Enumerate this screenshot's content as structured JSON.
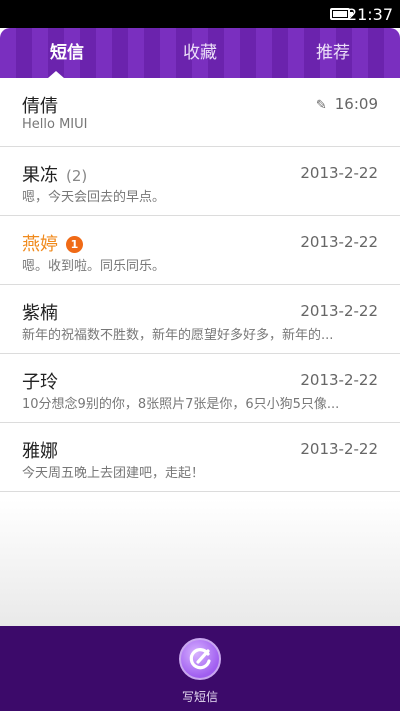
{
  "status": {
    "time": "21:37"
  },
  "tabs": [
    {
      "label": "短信"
    },
    {
      "label": "收藏"
    },
    {
      "label": "推荐"
    }
  ],
  "conversations": [
    {
      "name": "倩倩",
      "count": "",
      "badge": "",
      "date": "16:09",
      "draft_icon": "pencil-icon",
      "preview": "Hello MIUI"
    },
    {
      "name": "果冻",
      "count": "(2)",
      "badge": "",
      "date": "2013-2-22",
      "preview": "嗯，今天会回去的早点。"
    },
    {
      "name": "燕婷",
      "count": "",
      "badge": "1",
      "date": "2013-2-22",
      "preview": "嗯。收到啦。同乐同乐。"
    },
    {
      "name": "紫楠",
      "count": "",
      "badge": "",
      "date": "2013-2-22",
      "preview": "新年的祝福数不胜数，新年的愿望好多好多，新年的..."
    },
    {
      "name": "子玲",
      "count": "",
      "badge": "",
      "date": "2013-2-22",
      "preview": "10分想念9别的你，8张照片7张是你，6只小狗5只像..."
    },
    {
      "name": "雅娜",
      "count": "",
      "badge": "",
      "date": "2013-2-22",
      "preview": "今天周五晚上去团建吧，走起！"
    }
  ],
  "bottom": {
    "compose_label": "写短信",
    "compose_icon": "compose-icon"
  },
  "colors": {
    "accent": "#7a2fbf",
    "bottom_bar": "#3c0a6a",
    "unread": "#f08a1c",
    "badge": "#f06a16"
  }
}
